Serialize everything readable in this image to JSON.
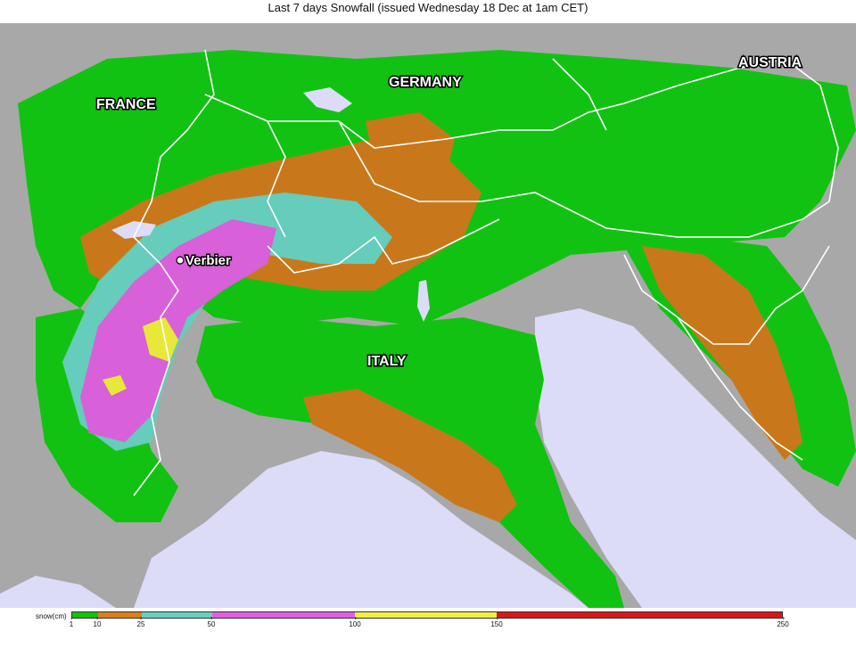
{
  "title": "Last 7 days Snowfall (issued Wednesday 18 Dec at 1am CET)",
  "map": {
    "labels": {
      "france": "FRANCE",
      "germany": "GERMANY",
      "austria": "AUSTRIA",
      "italy": "ITALY",
      "verbier": "Verbier"
    },
    "colors": {
      "terrain": "#a8a8a8",
      "sea": "#dcdcf8",
      "snow_1_10": "#12c212",
      "snow_10_25": "#c8781a",
      "snow_25_50": "#66ccbb",
      "snow_50_100": "#d860d8",
      "snow_100_150": "#e8e83a",
      "snow_150_250": "#d01818",
      "borders": "#ffffff"
    }
  },
  "legend": {
    "unit_label": "snow(cm)",
    "ticks": [
      "1",
      "10",
      "25",
      "50",
      "100",
      "150",
      "250"
    ],
    "segments": [
      {
        "from": 1,
        "to": 10,
        "color": "#12c212"
      },
      {
        "from": 10,
        "to": 25,
        "color": "#d8801a"
      },
      {
        "from": 25,
        "to": 50,
        "color": "#66d0c0"
      },
      {
        "from": 50,
        "to": 100,
        "color": "#e060e0"
      },
      {
        "from": 100,
        "to": 150,
        "color": "#f0f040"
      },
      {
        "from": 150,
        "to": 250,
        "color": "#d81818"
      }
    ]
  }
}
